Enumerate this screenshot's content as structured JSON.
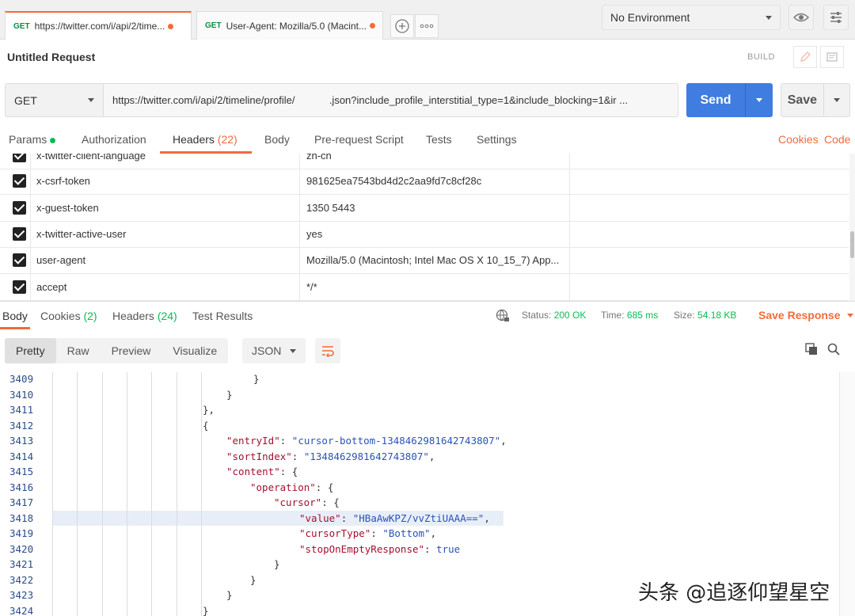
{
  "tabs": [
    {
      "method": "GET",
      "title": "https://twitter.com/i/api/2/time..."
    },
    {
      "method": "GET",
      "title": "User-Agent: Mozilla/5.0 (Macint..."
    }
  ],
  "environment": {
    "selected": "No Environment"
  },
  "request": {
    "title": "Untitled Request",
    "build_label": "BUILD",
    "method": "GET",
    "url": "https://twitter.com/i/api/2/timeline/profile/            .json?include_profile_interstitial_type=1&include_blocking=1&ir ...",
    "send_label": "Send",
    "save_label": "Save"
  },
  "request_tabs": {
    "params": "Params",
    "authorization": "Authorization",
    "headers": "Headers",
    "headers_count": "(22)",
    "body": "Body",
    "prerequest": "Pre-request Script",
    "tests": "Tests",
    "settings": "Settings",
    "cookies": "Cookies",
    "code": "Code"
  },
  "headers": [
    {
      "key": "x-twitter-client-language",
      "value": "zh-cn"
    },
    {
      "key": "x-csrf-token",
      "value": "981625ea7543bd4d2c2aa9fd7c8cf28c"
    },
    {
      "key": "x-guest-token",
      "value": "1350                5443"
    },
    {
      "key": "x-twitter-active-user",
      "value": "yes"
    },
    {
      "key": "user-agent",
      "value": "Mozilla/5.0 (Macintosh; Intel Mac OS X 10_15_7) App..."
    },
    {
      "key": "accept",
      "value": "*/*"
    }
  ],
  "response_tabs": {
    "body": "Body",
    "cookies": "Cookies",
    "cookies_count": "(2)",
    "headers": "Headers",
    "headers_count": "(24)",
    "test_results": "Test Results"
  },
  "response_status": {
    "status_label": "Status:",
    "status_value": "200 OK",
    "time_label": "Time:",
    "time_value": "685 ms",
    "size_label": "Size:",
    "size_value": "54.18 KB",
    "save_response": "Save Response"
  },
  "format": {
    "pretty": "Pretty",
    "raw": "Raw",
    "preview": "Preview",
    "visualize": "Visualize",
    "type": "JSON"
  },
  "code_lines": [
    {
      "n": "3409",
      "t": "}"
    },
    {
      "n": "3410",
      "t": "}"
    },
    {
      "n": "3411",
      "t": "},"
    },
    {
      "n": "3412",
      "t": "{"
    },
    {
      "n": "3413",
      "k": "\"entryId\"",
      "v": "\"cursor-bottom-1348462981642743807\"",
      "e": ","
    },
    {
      "n": "3414",
      "k": "\"sortIndex\"",
      "v": "\"1348462981642743807\"",
      "e": ","
    },
    {
      "n": "3415",
      "k": "\"content\"",
      "v": "{",
      "e": ""
    },
    {
      "n": "3416",
      "k": "\"operation\"",
      "v": "{",
      "e": ""
    },
    {
      "n": "3417",
      "k": "\"cursor\"",
      "v": "{",
      "e": ""
    },
    {
      "n": "3418",
      "k": "\"value\"",
      "v": "\"HBaAwKPZ/vvZtiUAAA==\"",
      "e": ","
    },
    {
      "n": "3419",
      "k": "\"cursorType\"",
      "v": "\"Bottom\"",
      "e": ","
    },
    {
      "n": "3420",
      "k": "\"stopOnEmptyResponse\"",
      "v": "true",
      "e": ""
    },
    {
      "n": "3421",
      "t": "}"
    },
    {
      "n": "3422",
      "t": "}"
    },
    {
      "n": "3423",
      "t": "}"
    },
    {
      "n": "3424",
      "t": "}"
    }
  ],
  "watermark": "头条 @追逐仰望星空"
}
